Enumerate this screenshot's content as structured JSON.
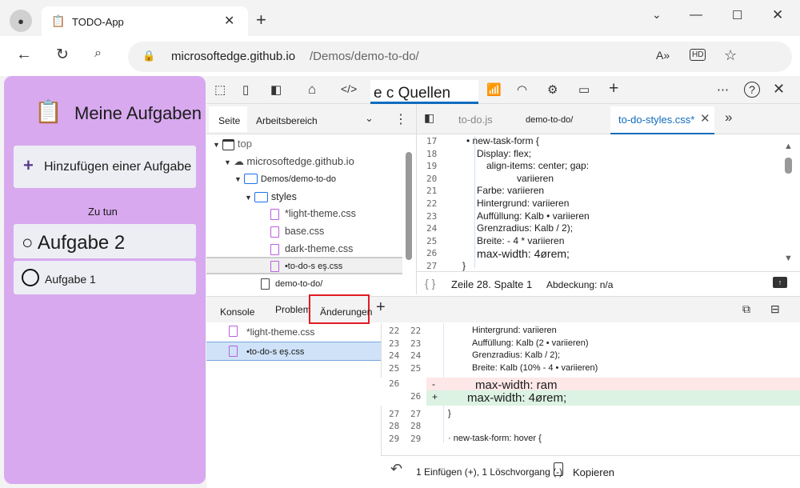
{
  "browser": {
    "tab_title": "TODO-App",
    "url_host": "microsoftedge.github.io",
    "url_path": "/Demos/demo-to-do/"
  },
  "app": {
    "title": "Meine Aufgaben",
    "add_task": "Hinzufügen einer Aufgabe",
    "section": "Zu tun",
    "tasks": [
      "Aufgabe 2",
      "Aufgabe 1"
    ]
  },
  "devtools": {
    "active_tool": "e c Quellen",
    "nav_tabs": [
      "Seite",
      "Arbeitsbereich"
    ],
    "tree": [
      "top",
      "microsoftedge.github.io",
      "Demos/demo-to-do",
      "styles",
      "*light-theme.css",
      "base.css",
      "dark-theme.css",
      "•to-do-s eş.css",
      "demo-to-do/"
    ],
    "editor_tabs": [
      "to-do.js",
      "demo-to-do/",
      "to-do-styles.css*"
    ],
    "code_lines": [
      {
        "n": "17",
        "t": "• new-task-form {"
      },
      {
        "n": "18",
        "t": "Display: flex;"
      },
      {
        "n": "19",
        "t": "align-items: center; gap:"
      },
      {
        "n": "20",
        "t": "variieren"
      },
      {
        "n": "21",
        "t": "Farbe: variieren"
      },
      {
        "n": "22",
        "t": "Hintergrund: variieren"
      },
      {
        "n": "23",
        "t": "Auffüllung: Kalb • variieren"
      },
      {
        "n": "24",
        "t": "Grenzradius: Kalb / 2);"
      },
      {
        "n": "25",
        "t": "Breite: - 4 * variieren"
      },
      {
        "n": "26",
        "t": "max-width: 4ørem;"
      },
      {
        "n": "27",
        "t": "}"
      }
    ],
    "status": {
      "position": "Zeile 28. Spalte 1",
      "coverage": "Abdeckung: n/a"
    },
    "drawer_tabs": [
      "Konsole",
      "Probleme",
      "Änderungen"
    ],
    "changed_files": [
      "*light-theme.css",
      "•to-do-s eş.css"
    ],
    "diff": [
      {
        "a": "22",
        "b": "22",
        "m": "",
        "t": "Hintergrund: variieren",
        "k": "ctx"
      },
      {
        "a": "23",
        "b": "23",
        "m": "",
        "t": "Auffüllung: Kalb (2 • variieren)",
        "k": "ctx"
      },
      {
        "a": "24",
        "b": "24",
        "m": "",
        "t": "Grenzradius: Kalb / 2);",
        "k": "ctx"
      },
      {
        "a": "25",
        "b": "25",
        "m": "",
        "t": "Breite: Kalb (10% - 4 • variieren)",
        "k": "ctx"
      },
      {
        "a": "26",
        "b": "",
        "m": "-",
        "t": "max-width: ram",
        "k": "del"
      },
      {
        "a": "",
        "b": "26",
        "m": "+",
        "t": "max-width: 4ørem;",
        "k": "add"
      },
      {
        "a": "27",
        "b": "27",
        "m": "",
        "t": "}",
        "k": "ctx"
      },
      {
        "a": "28",
        "b": "28",
        "m": "",
        "t": "",
        "k": "ctx"
      },
      {
        "a": "29",
        "b": "29",
        "m": "",
        "t": "· new-task-form: hover {",
        "k": "ctx"
      }
    ],
    "summary": "1 Einfügen (+), 1 Löschvorgang (-)",
    "copy": "Kopieren"
  },
  "colors": {
    "app_bg": "#d8a9ef",
    "accent": "#0f6cbd",
    "del": "#fde7e7",
    "add": "#dcf2e2",
    "highlight": "#e31b23"
  }
}
